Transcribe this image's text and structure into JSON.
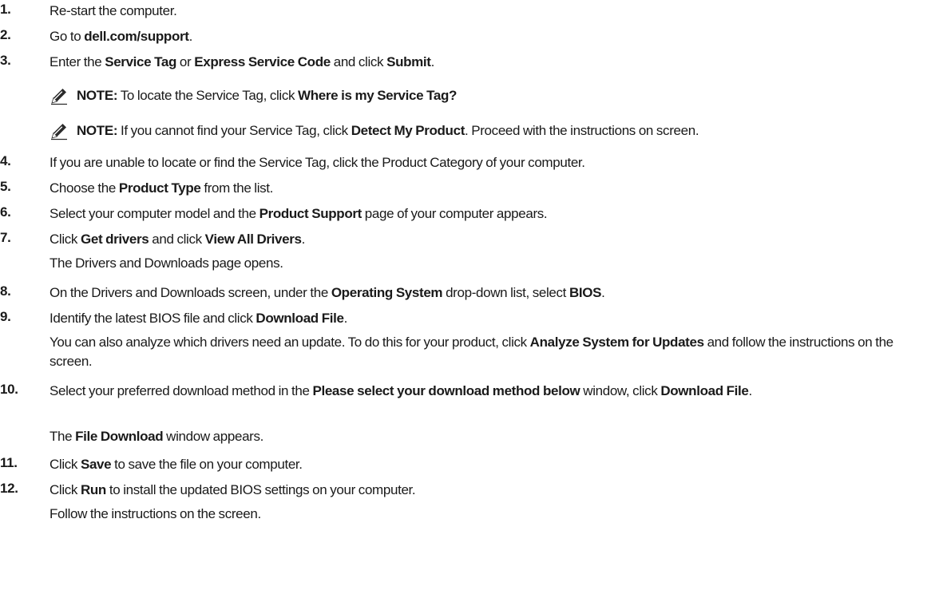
{
  "steps": [
    {
      "num": "1.",
      "parts": [
        {
          "t": "Re-start the computer."
        }
      ]
    },
    {
      "num": "2.",
      "parts": [
        {
          "t": "Go to "
        },
        {
          "t": "dell.com/support",
          "b": true
        },
        {
          "t": "."
        }
      ]
    },
    {
      "num": "3.",
      "parts": [
        {
          "t": "Enter the "
        },
        {
          "t": "Service Tag",
          "b": true
        },
        {
          "t": " or "
        },
        {
          "t": "Express Service Code",
          "b": true
        },
        {
          "t": " and click "
        },
        {
          "t": "Submit",
          "b": true
        },
        {
          "t": "."
        }
      ]
    },
    {
      "num": "4.",
      "parts": [
        {
          "t": "If you are unable to locate or find the Service Tag, click the Product Category of your computer."
        }
      ]
    },
    {
      "num": "5.",
      "parts": [
        {
          "t": "Choose the "
        },
        {
          "t": "Product Type",
          "b": true
        },
        {
          "t": " from the list."
        }
      ]
    },
    {
      "num": "6.",
      "parts": [
        {
          "t": "Select your computer model and the "
        },
        {
          "t": "Product Support",
          "b": true
        },
        {
          "t": " page of your computer appears."
        }
      ]
    },
    {
      "num": "7.",
      "parts": [
        {
          "t": "Click "
        },
        {
          "t": "Get drivers",
          "b": true
        },
        {
          "t": " and click "
        },
        {
          "t": "View All Drivers",
          "b": true
        },
        {
          "t": "."
        }
      ]
    },
    {
      "num": "8.",
      "parts": [
        {
          "t": "On the Drivers and Downloads screen, under the "
        },
        {
          "t": "Operating System",
          "b": true
        },
        {
          "t": " drop-down list, select "
        },
        {
          "t": "BIOS",
          "b": true
        },
        {
          "t": "."
        }
      ]
    },
    {
      "num": "9.",
      "parts": [
        {
          "t": "Identify the latest BIOS file and click "
        },
        {
          "t": "Download File",
          "b": true
        },
        {
          "t": "."
        }
      ]
    },
    {
      "num": "10.",
      "parts": [
        {
          "t": "Select your preferred download method in the "
        },
        {
          "t": "Please select your download method below",
          "b": true
        },
        {
          "t": " window, click "
        },
        {
          "t": "Download File",
          "b": true
        },
        {
          "t": "."
        }
      ]
    },
    {
      "num": "11.",
      "parts": [
        {
          "t": "Click "
        },
        {
          "t": "Save",
          "b": true
        },
        {
          "t": " to save the file on your computer."
        }
      ]
    },
    {
      "num": "12.",
      "parts": [
        {
          "t": "Click "
        },
        {
          "t": "Run",
          "b": true
        },
        {
          "t": " to install the updated BIOS settings on your computer."
        }
      ]
    }
  ],
  "notes": [
    {
      "parts": [
        {
          "t": "NOTE:",
          "b": true
        },
        {
          "t": " To locate the Service Tag, click "
        },
        {
          "t": "Where is my Service Tag?",
          "b": true
        }
      ]
    },
    {
      "parts": [
        {
          "t": "NOTE:",
          "b": true
        },
        {
          "t": " If you cannot find your Service Tag, click "
        },
        {
          "t": "Detect My Product",
          "b": true
        },
        {
          "t": ". Proceed with the instructions on screen."
        }
      ]
    }
  ],
  "subtexts": {
    "step7": [
      {
        "t": "The Drivers and Downloads page opens."
      }
    ],
    "step9": [
      {
        "t": "You can also analyze which drivers need an update. To do this for your product, click "
      },
      {
        "t": "Analyze System for Updates",
        "b": true
      },
      {
        "t": " and follow the instructions on the screen."
      }
    ],
    "step10": [
      {
        "t": "The "
      },
      {
        "t": "File Download",
        "b": true
      },
      {
        "t": " window appears."
      }
    ],
    "step12": [
      {
        "t": "Follow the instructions on the screen."
      }
    ]
  },
  "icons": {
    "note": "pencil-note-icon"
  }
}
